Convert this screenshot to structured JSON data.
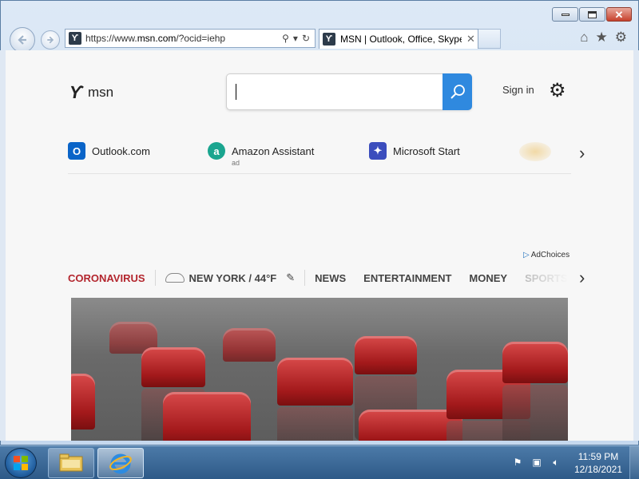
{
  "browser": {
    "address_url_prefix": "https://www.",
    "address_url_domain": "msn.com",
    "address_url_suffix": "/?ocid=iehp",
    "tab_title": "MSN | Outlook, Office, Skype, Bing, Breaking News, and Latest Videos",
    "tab_close": "✕"
  },
  "page": {
    "logo_text": "msn",
    "signin_label": "Sign in",
    "quick_links": [
      {
        "label": "Outlook.com",
        "color": "#0a64c8",
        "icon": "outlook-icon"
      },
      {
        "label": "Amazon Assistant",
        "ad": "ad",
        "color": "#1aa58f",
        "icon": "amazon-icon"
      },
      {
        "label": "Microsoft Start",
        "color": "#3b4dbd",
        "icon": "microsoft-start-icon"
      }
    ],
    "adchoices_label": "AdChoices",
    "categories": {
      "coronavirus": "CORONAVIRUS",
      "weather": "NEW YORK / 44°F",
      "news": "NEWS",
      "entertainment": "ENTERTAINMENT",
      "money": "MONEY",
      "sports": "SPORTS"
    }
  },
  "taskbar": {
    "time": "11:59 PM",
    "date": "12/18/2021"
  },
  "colors": {
    "accent": "#2f89df",
    "coronavirus_red": "#b3262e"
  }
}
